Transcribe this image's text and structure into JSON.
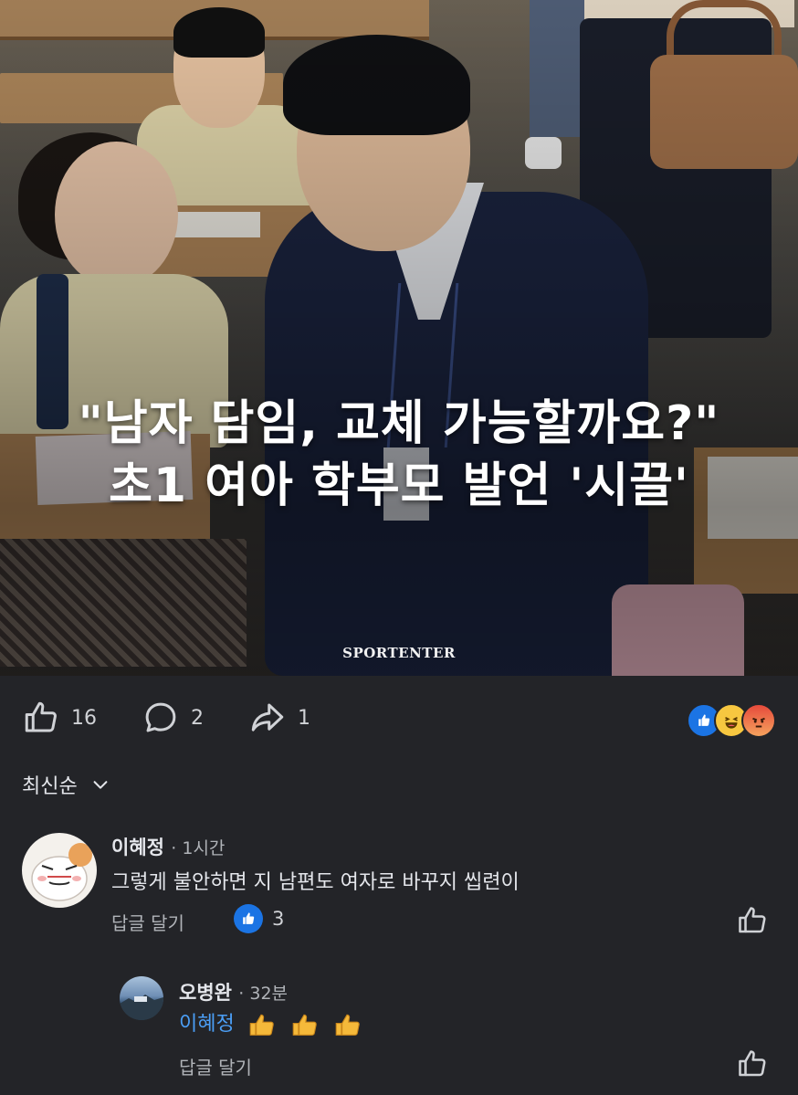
{
  "post": {
    "headline_line1": "\"남자 담임, 교체 가능할까요?\"",
    "headline_line2": "초1 여아 학부모 발언 '시끌'",
    "watermark": "SPORTENTER"
  },
  "actions": {
    "like_count": "16",
    "comment_count": "2",
    "share_count": "1"
  },
  "reactions": [
    "like-reaction-icon",
    "haha-reaction-icon",
    "angry-reaction-icon"
  ],
  "sort": {
    "label": "최신순"
  },
  "comments": [
    {
      "name": "이혜정",
      "time": "· 1시간",
      "text": "그렇게 불안하면 지 남편도 여자로 바꾸지 씹련이",
      "reply_label": "답글 달기",
      "like_count": "3"
    }
  ],
  "replies": [
    {
      "name": "오병완",
      "time": "· 32분",
      "mention": "이혜정",
      "emoji": "thumbs-up-emoji x3",
      "reply_label": "답글 달기"
    }
  ],
  "colors": {
    "background": "#232428",
    "text": "#e4e6eb",
    "muted": "#b0b3b8",
    "accent_blue": "#1b74e4",
    "mention": "#4b9ef5"
  }
}
